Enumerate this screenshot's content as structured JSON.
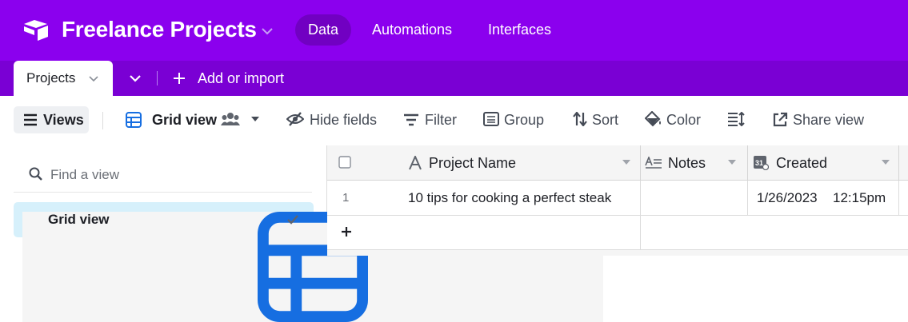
{
  "header": {
    "base_title": "Freelance Projects",
    "nav_tabs": [
      {
        "label": "Data",
        "active": true
      },
      {
        "label": "Automations",
        "active": false
      },
      {
        "label": "Interfaces",
        "active": false
      }
    ],
    "brand_color": "#8b00ee"
  },
  "tables": {
    "active_tab": "Projects",
    "add_label": "Add or import"
  },
  "viewbar": {
    "views_label": "Views",
    "current_view": "Grid view",
    "hide_fields": "Hide fields",
    "filter": "Filter",
    "group": "Group",
    "sort": "Sort",
    "color": "Color",
    "share_view": "Share view"
  },
  "sidebar": {
    "search_placeholder": "Find a view",
    "views": [
      {
        "label": "Grid view",
        "selected": true
      }
    ]
  },
  "grid": {
    "columns": [
      {
        "label": "Project Name",
        "icon": "text-field-icon"
      },
      {
        "label": "Notes",
        "icon": "long-text-icon"
      },
      {
        "label": "Created",
        "icon": "created-time-icon"
      }
    ],
    "rows": [
      {
        "num": "1",
        "project_name": "10 tips for cooking a perfect steak",
        "notes": "",
        "created_date": "1/26/2023",
        "created_time": "12:15pm"
      }
    ],
    "add_row_symbol": "+"
  }
}
